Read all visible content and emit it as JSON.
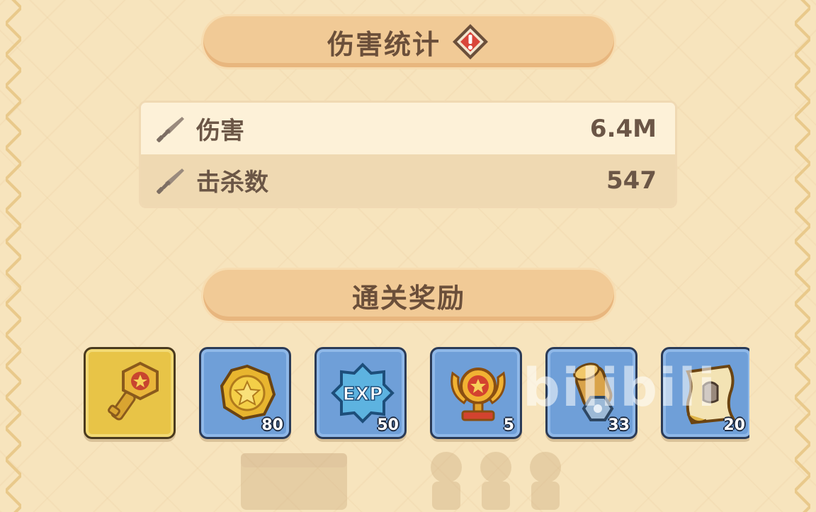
{
  "damage_stats": {
    "title": "伤害统计",
    "rows": [
      {
        "label": "伤害",
        "value": "6.4M"
      },
      {
        "label": "击杀数",
        "value": "547"
      }
    ]
  },
  "rewards_section": {
    "title": "通关奖励",
    "items": [
      {
        "icon": "key-icon",
        "count": ""
      },
      {
        "icon": "gold-coin-icon",
        "count": "80"
      },
      {
        "icon": "exp-badge-icon",
        "count": "50"
      },
      {
        "icon": "trophy-icon",
        "count": "5"
      },
      {
        "icon": "scroll-material-icon",
        "count": "33"
      },
      {
        "icon": "map-scroll-icon",
        "count": "20"
      }
    ]
  },
  "watermark": "bilibili",
  "colors": {
    "background": "#f7e4bd",
    "header_fill": "#f1ca96",
    "text_brown": "#6b4f3a",
    "tile_blue": "#6f9fd8",
    "tile_gold": "#e8c447"
  }
}
